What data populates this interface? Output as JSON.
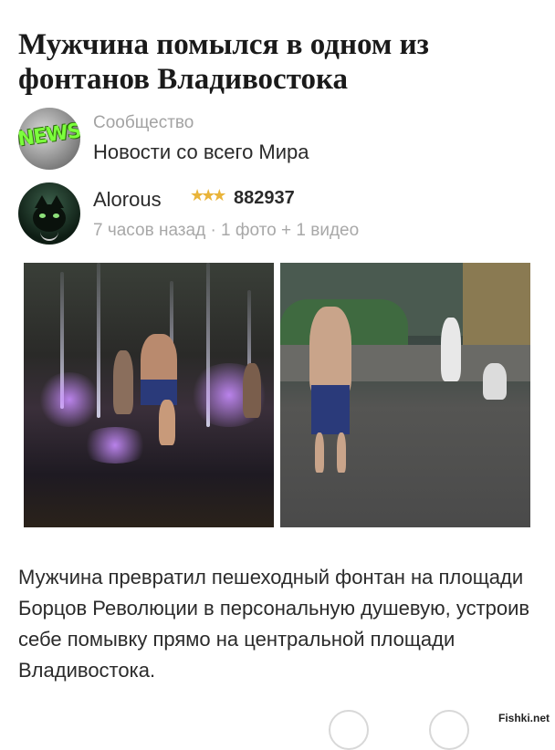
{
  "post": {
    "title": "Мужчина помылся в одном из фонтанов Владивостока",
    "community": {
      "label": "Сообщество",
      "name": "Новости со всего Мира",
      "avatar_text": "NEWS"
    },
    "author": {
      "name": "Alorous",
      "rating": "882937",
      "meta": "7 часов назад · 1 фото + 1 видео"
    },
    "caption": "Мужчина превратил пешеходный фонтан на площади Борцов Революции в персональную душевую, устроив себе помывку прямо на центральной площади Владивостока."
  },
  "watermark": "Fishki.net",
  "colors": {
    "accent_green": "#7cff3c",
    "stars": "#e9b43a",
    "muted": "#a3a3a3"
  },
  "icons": [
    "news-avatar",
    "cat-avatar",
    "rating-stars-icon"
  ]
}
